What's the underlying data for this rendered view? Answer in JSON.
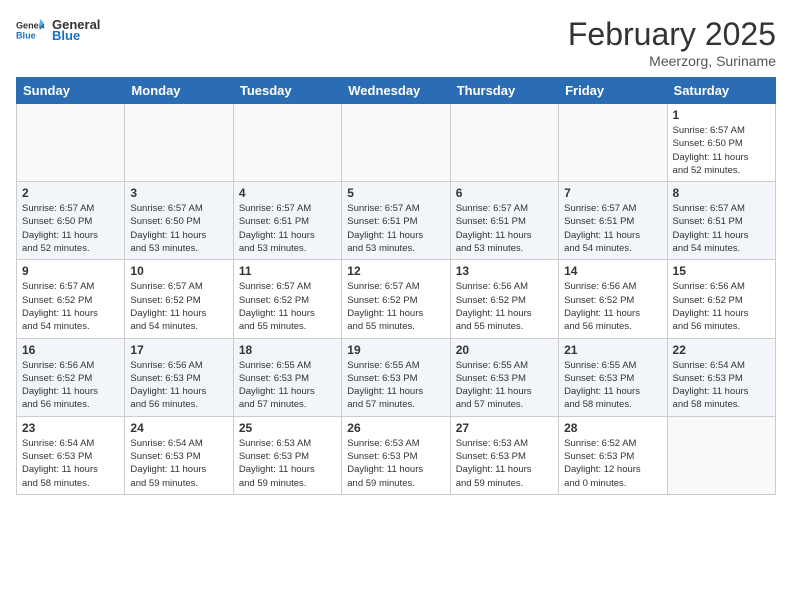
{
  "header": {
    "logo_general": "General",
    "logo_blue": "Blue",
    "month_title": "February 2025",
    "location": "Meerzorg, Suriname"
  },
  "days_of_week": [
    "Sunday",
    "Monday",
    "Tuesday",
    "Wednesday",
    "Thursday",
    "Friday",
    "Saturday"
  ],
  "weeks": [
    [
      {
        "day": "",
        "info": ""
      },
      {
        "day": "",
        "info": ""
      },
      {
        "day": "",
        "info": ""
      },
      {
        "day": "",
        "info": ""
      },
      {
        "day": "",
        "info": ""
      },
      {
        "day": "",
        "info": ""
      },
      {
        "day": "1",
        "info": "Sunrise: 6:57 AM\nSunset: 6:50 PM\nDaylight: 11 hours\nand 52 minutes."
      }
    ],
    [
      {
        "day": "2",
        "info": "Sunrise: 6:57 AM\nSunset: 6:50 PM\nDaylight: 11 hours\nand 52 minutes."
      },
      {
        "day": "3",
        "info": "Sunrise: 6:57 AM\nSunset: 6:50 PM\nDaylight: 11 hours\nand 53 minutes."
      },
      {
        "day": "4",
        "info": "Sunrise: 6:57 AM\nSunset: 6:51 PM\nDaylight: 11 hours\nand 53 minutes."
      },
      {
        "day": "5",
        "info": "Sunrise: 6:57 AM\nSunset: 6:51 PM\nDaylight: 11 hours\nand 53 minutes."
      },
      {
        "day": "6",
        "info": "Sunrise: 6:57 AM\nSunset: 6:51 PM\nDaylight: 11 hours\nand 53 minutes."
      },
      {
        "day": "7",
        "info": "Sunrise: 6:57 AM\nSunset: 6:51 PM\nDaylight: 11 hours\nand 54 minutes."
      },
      {
        "day": "8",
        "info": "Sunrise: 6:57 AM\nSunset: 6:51 PM\nDaylight: 11 hours\nand 54 minutes."
      }
    ],
    [
      {
        "day": "9",
        "info": "Sunrise: 6:57 AM\nSunset: 6:52 PM\nDaylight: 11 hours\nand 54 minutes."
      },
      {
        "day": "10",
        "info": "Sunrise: 6:57 AM\nSunset: 6:52 PM\nDaylight: 11 hours\nand 54 minutes."
      },
      {
        "day": "11",
        "info": "Sunrise: 6:57 AM\nSunset: 6:52 PM\nDaylight: 11 hours\nand 55 minutes."
      },
      {
        "day": "12",
        "info": "Sunrise: 6:57 AM\nSunset: 6:52 PM\nDaylight: 11 hours\nand 55 minutes."
      },
      {
        "day": "13",
        "info": "Sunrise: 6:56 AM\nSunset: 6:52 PM\nDaylight: 11 hours\nand 55 minutes."
      },
      {
        "day": "14",
        "info": "Sunrise: 6:56 AM\nSunset: 6:52 PM\nDaylight: 11 hours\nand 56 minutes."
      },
      {
        "day": "15",
        "info": "Sunrise: 6:56 AM\nSunset: 6:52 PM\nDaylight: 11 hours\nand 56 minutes."
      }
    ],
    [
      {
        "day": "16",
        "info": "Sunrise: 6:56 AM\nSunset: 6:52 PM\nDaylight: 11 hours\nand 56 minutes."
      },
      {
        "day": "17",
        "info": "Sunrise: 6:56 AM\nSunset: 6:53 PM\nDaylight: 11 hours\nand 56 minutes."
      },
      {
        "day": "18",
        "info": "Sunrise: 6:55 AM\nSunset: 6:53 PM\nDaylight: 11 hours\nand 57 minutes."
      },
      {
        "day": "19",
        "info": "Sunrise: 6:55 AM\nSunset: 6:53 PM\nDaylight: 11 hours\nand 57 minutes."
      },
      {
        "day": "20",
        "info": "Sunrise: 6:55 AM\nSunset: 6:53 PM\nDaylight: 11 hours\nand 57 minutes."
      },
      {
        "day": "21",
        "info": "Sunrise: 6:55 AM\nSunset: 6:53 PM\nDaylight: 11 hours\nand 58 minutes."
      },
      {
        "day": "22",
        "info": "Sunrise: 6:54 AM\nSunset: 6:53 PM\nDaylight: 11 hours\nand 58 minutes."
      }
    ],
    [
      {
        "day": "23",
        "info": "Sunrise: 6:54 AM\nSunset: 6:53 PM\nDaylight: 11 hours\nand 58 minutes."
      },
      {
        "day": "24",
        "info": "Sunrise: 6:54 AM\nSunset: 6:53 PM\nDaylight: 11 hours\nand 59 minutes."
      },
      {
        "day": "25",
        "info": "Sunrise: 6:53 AM\nSunset: 6:53 PM\nDaylight: 11 hours\nand 59 minutes."
      },
      {
        "day": "26",
        "info": "Sunrise: 6:53 AM\nSunset: 6:53 PM\nDaylight: 11 hours\nand 59 minutes."
      },
      {
        "day": "27",
        "info": "Sunrise: 6:53 AM\nSunset: 6:53 PM\nDaylight: 11 hours\nand 59 minutes."
      },
      {
        "day": "28",
        "info": "Sunrise: 6:52 AM\nSunset: 6:53 PM\nDaylight: 12 hours\nand 0 minutes."
      },
      {
        "day": "",
        "info": ""
      }
    ]
  ]
}
